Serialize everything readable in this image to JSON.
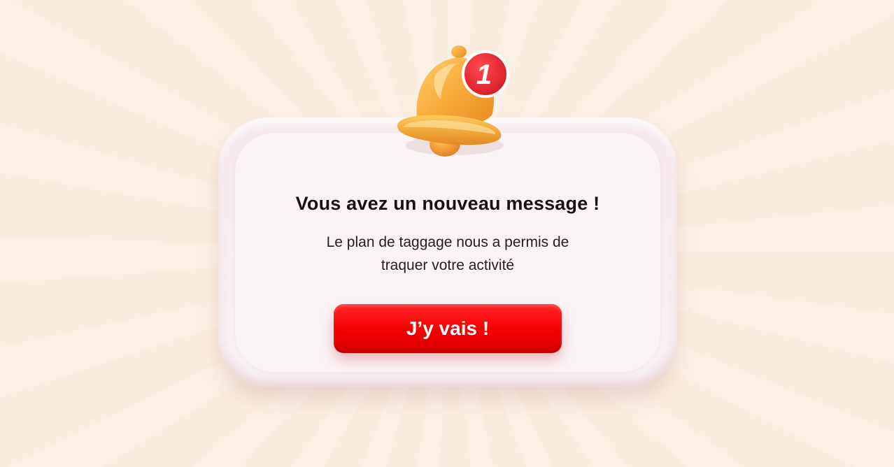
{
  "notification": {
    "title": "Vous avez un nouveau message !",
    "body": "Le plan de taggage nous a permis de traquer votre activité",
    "badge_count": "1",
    "cta_label": "J’y vais !"
  },
  "colors": {
    "background": "#FAEDDF",
    "card": "#FBF4F7",
    "cta": "#F40000",
    "bell": "#F7A73A",
    "badge": "#E3262E"
  },
  "icons": {
    "bell": "bell-icon",
    "badge": "notification-badge"
  }
}
